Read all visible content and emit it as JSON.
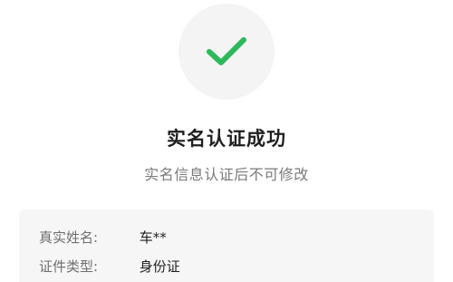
{
  "success_icon": {
    "name": "checkmark-icon",
    "color": "#2eb85c",
    "background": "#f4f4f4"
  },
  "title": "实名认证成功",
  "subtitle": "实名信息认证后不可修改",
  "info": {
    "rows": [
      {
        "label": "真实姓名:",
        "value": "车**"
      },
      {
        "label": "证件类型:",
        "value": "身份证"
      }
    ]
  }
}
